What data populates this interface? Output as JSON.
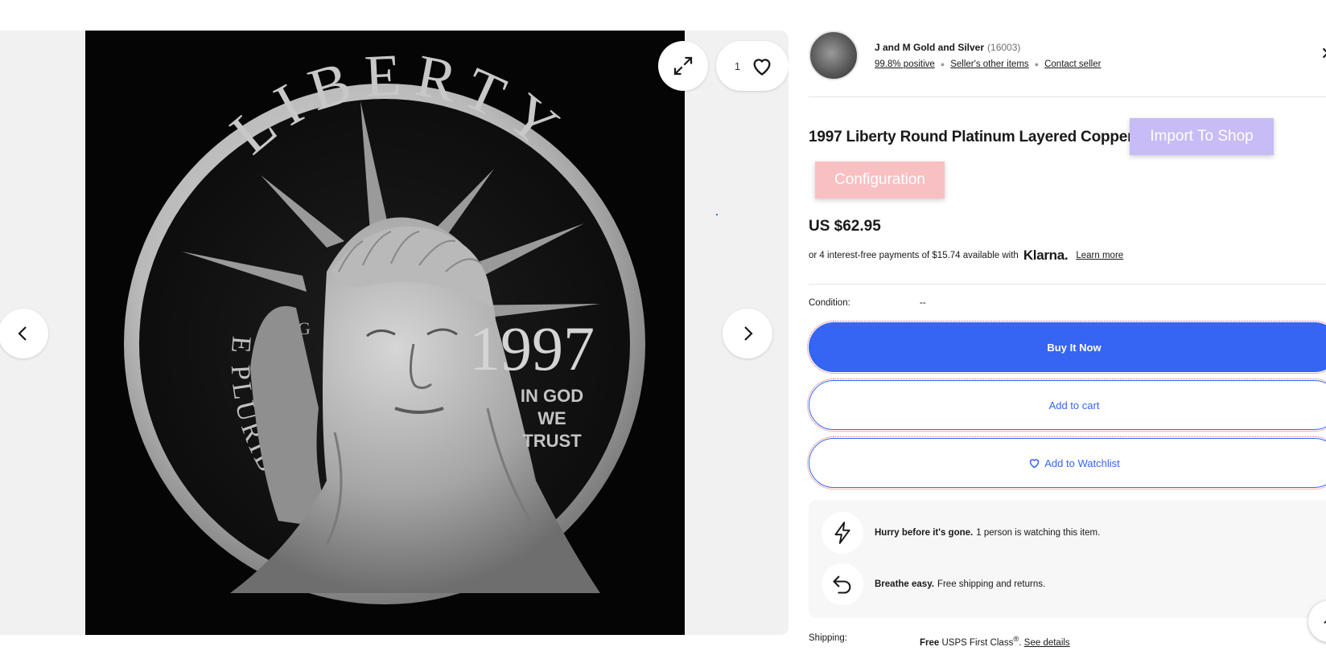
{
  "gallery": {
    "favorite_count": "1",
    "coin": {
      "legend_top": "LIBERTY",
      "year": "1997",
      "motto_line1": "IN GOD",
      "motto_line2": "WE",
      "motto_line3": "TRUST",
      "legend_left": "E PLURIBUS UNUM",
      "mint_mark": "G"
    }
  },
  "seller": {
    "name": "J and M Gold and Silver",
    "feedback_count": "(16003)",
    "positive": "99.8% positive",
    "other_items": "Seller's other items",
    "contact": "Contact seller"
  },
  "listing": {
    "title": "1997 Liberty Round Platinum Layered Copper",
    "price": "US $62.95",
    "klarna_text": "or 4 interest-free payments of $15.74 available with",
    "klarna_logo": "Klarna.",
    "learn_more": "Learn more",
    "condition_label": "Condition:",
    "condition_value": "--"
  },
  "extension": {
    "import_label": "Import To Shop",
    "config_label": "Configuration"
  },
  "actions": {
    "buy_now": "Buy It Now",
    "add_to_cart": "Add to cart",
    "add_to_watchlist": "Add to Watchlist"
  },
  "promos": [
    {
      "bold": "Hurry before it's gone.",
      "text": "1 person is watching this item."
    },
    {
      "bold": "Breathe easy.",
      "text": "Free shipping and returns."
    }
  ],
  "shipping": {
    "label": "Shipping:",
    "free": "Free",
    "method": "USPS First Class",
    "reg": "®",
    "details": "See details"
  },
  "colors": {
    "accent": "#3665f3",
    "import_button": "#c7bcf5",
    "config_button": "#f8c0c3"
  }
}
